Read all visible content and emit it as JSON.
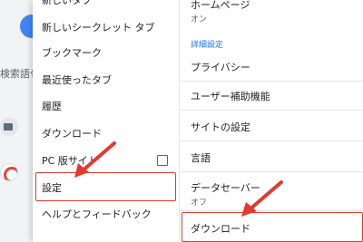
{
  "background_page": {
    "search_hint": "検索語句を"
  },
  "overflow_menu": {
    "items": [
      {
        "label": "新しいタブ"
      },
      {
        "label": "新しいシークレット タブ"
      },
      {
        "label": "ブックマーク"
      },
      {
        "label": "最近使ったタブ"
      },
      {
        "label": "履歴"
      },
      {
        "label": "ダウンロード"
      },
      {
        "label": "PC 版サイト",
        "checked": false
      },
      {
        "label": "設定",
        "highlighted": true
      },
      {
        "label": "ヘルプとフィードバック"
      }
    ]
  },
  "settings": {
    "homepage": {
      "title": "ホームページ",
      "sub": "オン"
    },
    "section_header": "詳細設定",
    "items": [
      {
        "title": "プライバシー"
      },
      {
        "title": "ユーザー補助機能"
      },
      {
        "title": "サイトの設定"
      },
      {
        "title": "言語"
      },
      {
        "title": "データセーバー",
        "sub": "オフ"
      },
      {
        "title": "ダウンロード",
        "highlighted": true
      }
    ]
  },
  "colors": {
    "annotation_red": "#e23a2f",
    "link_blue": "#1a73e8"
  }
}
